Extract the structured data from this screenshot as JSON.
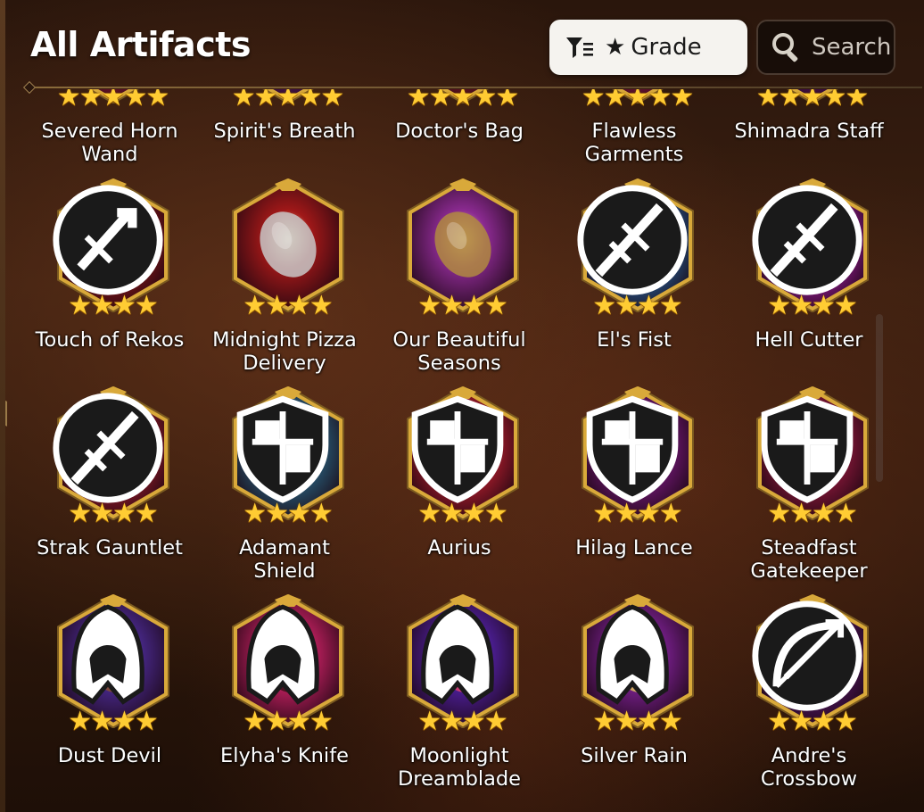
{
  "header": {
    "title": "All Artifacts",
    "grade_button": {
      "star": "★",
      "label": "Grade"
    },
    "search_button": {
      "label": "Search"
    }
  },
  "colors": {
    "star_gold": "#ffcc33",
    "frame_gold": "#d9a93a",
    "grade_button_bg": "#f5f3ef"
  },
  "artifacts": [
    {
      "name": "Severed Horn Wand",
      "stars": 5,
      "class_icon": "",
      "art": "#3a8a6a",
      "bg": "#b02040"
    },
    {
      "name": "Spirit's Breath",
      "stars": 5,
      "class_icon": "",
      "art": "#c03060",
      "bg": "#6a2080"
    },
    {
      "name": "Doctor's Bag",
      "stars": 5,
      "class_icon": "",
      "art": "#7a5030",
      "bg": "#a02030"
    },
    {
      "name": "Flawless Garments",
      "stars": 5,
      "class_icon": "",
      "art": "#d0a040",
      "bg": "#b02050"
    },
    {
      "name": "Shimadra Staff",
      "stars": 5,
      "class_icon": "",
      "art": "#9040c0",
      "bg": "#6a1a7a"
    },
    {
      "name": "Touch of Rekos",
      "stars": 4,
      "class_icon": "knight-sword-icon",
      "art": "#e0b030",
      "bg": "#9a1a1a"
    },
    {
      "name": "Midnight Pizza Delivery",
      "stars": 4,
      "class_icon": "",
      "art": "#c8c8c8",
      "bg": "#a01818"
    },
    {
      "name": "Our Beautiful Seasons",
      "stars": 4,
      "class_icon": "",
      "art": "#b08a40",
      "bg": "#8a2a90"
    },
    {
      "name": "El's Fist",
      "stars": 4,
      "class_icon": "warrior-sword-icon",
      "art": "#c0a060",
      "bg": "#2a70b0"
    },
    {
      "name": "Hell Cutter",
      "stars": 4,
      "class_icon": "warrior-sword-icon",
      "art": "#3a2030",
      "bg": "#b020b0"
    },
    {
      "name": "Strak Gauntlet",
      "stars": 4,
      "class_icon": "warrior-sword-icon",
      "art": "#5a2a50",
      "bg": "#b02030"
    },
    {
      "name": "Adamant Shield",
      "stars": 4,
      "class_icon": "knight-shield-icon",
      "art": "#d8c070",
      "bg": "#2a6a8a"
    },
    {
      "name": "Aurius",
      "stars": 4,
      "class_icon": "knight-shield-icon",
      "art": "#e0e0e8",
      "bg": "#c02030"
    },
    {
      "name": "Hilag Lance",
      "stars": 4,
      "class_icon": "knight-shield-icon",
      "art": "#c02050",
      "bg": "#7a1a80"
    },
    {
      "name": "Steadfast Gatekeeper",
      "stars": 4,
      "class_icon": "knight-shield-icon",
      "art": "#e0d0b0",
      "bg": "#9a1a40"
    },
    {
      "name": "Dust Devil",
      "stars": 4,
      "class_icon": "thief-hood-icon",
      "art": "#8a5030",
      "bg": "#4a2a90"
    },
    {
      "name": "Elyha's Knife",
      "stars": 4,
      "class_icon": "thief-hood-icon",
      "art": "#3a1018",
      "bg": "#c02060"
    },
    {
      "name": "Moonlight Dreamblade",
      "stars": 4,
      "class_icon": "thief-hood-icon",
      "art": "#e04070",
      "bg": "#5020a0"
    },
    {
      "name": "Silver Rain",
      "stars": 4,
      "class_icon": "thief-hood-icon",
      "art": "#e0c060",
      "bg": "#7a2090"
    },
    {
      "name": "Andre's Crossbow",
      "stars": 4,
      "class_icon": "ranger-bow-icon",
      "art": "#9a3a20",
      "bg": "#5a1a70"
    }
  ]
}
